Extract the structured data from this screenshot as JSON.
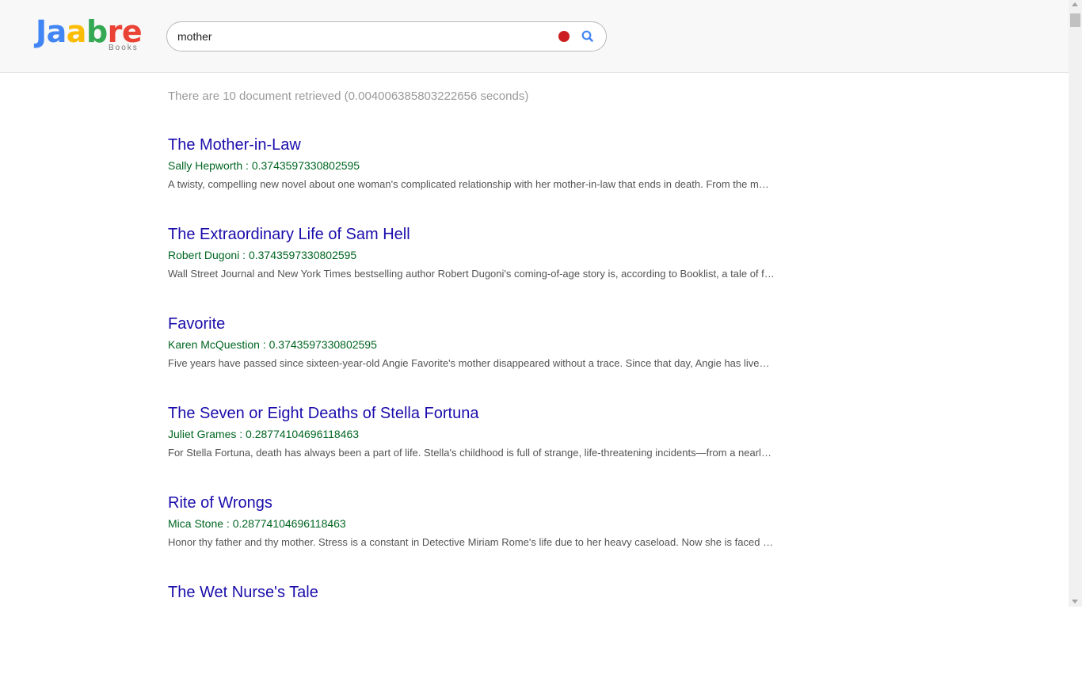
{
  "logo": {
    "letters": [
      {
        "char": "J",
        "color": "#4285f4"
      },
      {
        "char": "a",
        "color": "#4285f4"
      },
      {
        "char": "a",
        "color": "#fbbc05"
      },
      {
        "char": "b",
        "color": "#34a853"
      },
      {
        "char": "r",
        "color": "#ea4335"
      },
      {
        "char": "e",
        "color": "#ea4335"
      }
    ],
    "subtitle": "Books"
  },
  "search": {
    "query": "mother",
    "placeholder": ""
  },
  "stats": "There are 10 document retrieved (0.004006385803222656 seconds)",
  "results": [
    {
      "title": "The Mother-in-Law",
      "author": "Sally Hepworth",
      "score": "0.3743597330802595",
      "description": "A twisty, compelling new novel about one woman's complicated relationship with her mother-in-law that ends in death. From the moment Lucy met her husband's mother Diana"
    },
    {
      "title": "The Extraordinary Life of Sam Hell",
      "author": "Robert Dugoni",
      "score": "0.3743597330802595",
      "description": "Wall Street Journal and New York Times bestselling author Robert Dugoni's coming-of-age story is, according to Booklist, a tale of friendship, family, and the lasting scars of bullying"
    },
    {
      "title": "Favorite",
      "author": "Karen McQuestion",
      "score": "0.3743597330802595",
      "description": "Five years have passed since sixteen-year-old Angie Favorite's mother disappeared without a trace. Since that day, Angie has lived with the hope that she will return"
    },
    {
      "title": "The Seven or Eight Deaths of Stella Fortuna",
      "author": "Juliet Grames",
      "score": "0.28774104696118463",
      "description": "For Stella Fortuna, death has always been a part of life. Stella's childhood is full of strange, life-threatening incidents—from a nearly fatal bout with a dangerous pig"
    },
    {
      "title": "Rite of Wrongs",
      "author": "Mica Stone",
      "score": "0.28774104696118463",
      "description": "Honor thy father and thy mother. Stress is a constant in Detective Miriam Rome's life due to her heavy caseload. Now she is faced with the brutal killing"
    },
    {
      "title": "The Wet Nurse's Tale",
      "author": "",
      "score": "",
      "description": ""
    }
  ]
}
